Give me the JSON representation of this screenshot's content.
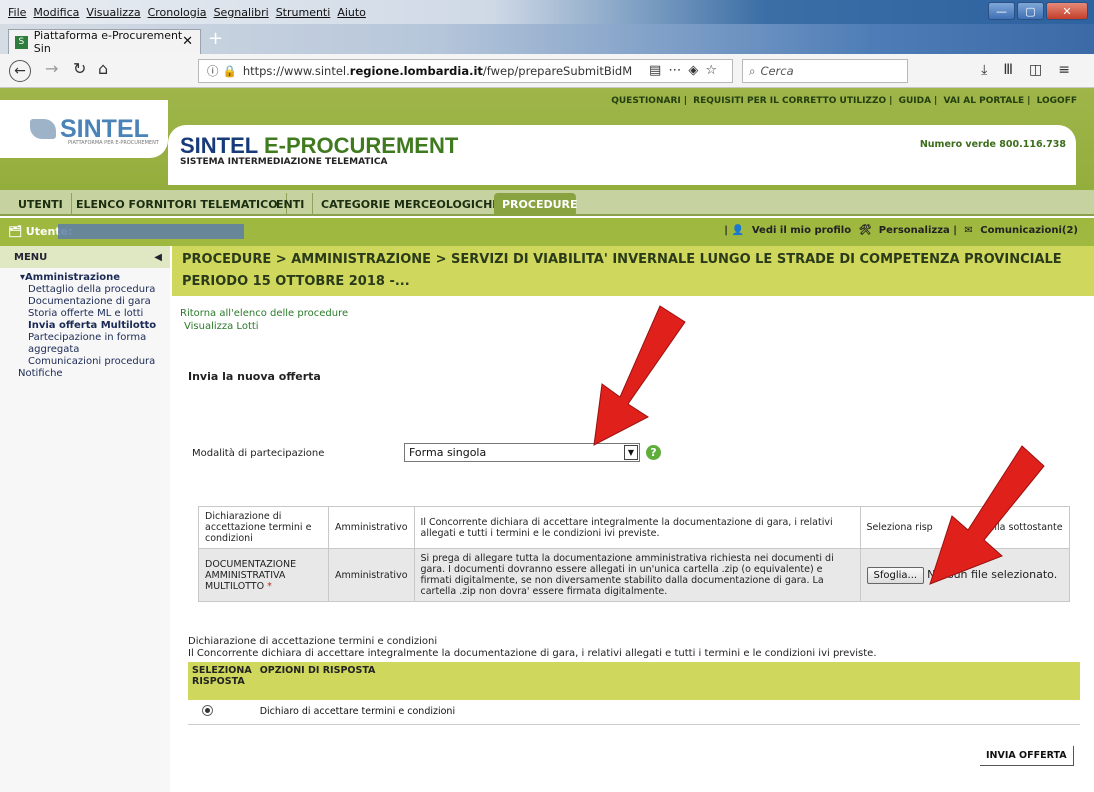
{
  "browser": {
    "menu": [
      "File",
      "Modifica",
      "Visualizza",
      "Cronologia",
      "Segnalibri",
      "Strumenti",
      "Aiuto"
    ],
    "tab_title": "Piattaforma e-Procurement Sin",
    "url_prefix": "https://www.sintel.",
    "url_domain": "regione.lombardia.it",
    "url_path": "/fwep/prepareSubmitBidM",
    "search_placeholder": "Cerca"
  },
  "site": {
    "logo_text": "SINTEL",
    "logo_sub": "PIATTAFORMA PER E-PROCUREMENT",
    "top_links": [
      "QUESTIONARI",
      "REQUISITI PER IL CORRETTO UTILIZZO",
      "GUIDA",
      "VAI AL PORTALE",
      "LOGOFF"
    ],
    "title_a": "SINTEL ",
    "title_b": "E-PROCUREMENT",
    "subtitle": "SISTEMA INTERMEDIAZIONE TELEMATICA",
    "numero_verde": "Numero verde 800.116.738"
  },
  "nav_tabs": [
    "UTENTI",
    "ELENCO FORNITORI TELEMATICO",
    "ENTI",
    "CATEGORIE MERCEOLOGICHE",
    "PROCEDURE"
  ],
  "userbar": {
    "user_label": "Utente:",
    "profile": "Vedi il mio profilo",
    "personalizza": "Personalizza",
    "comunicazioni": "Comunicazioni(2)"
  },
  "sidebar": {
    "menu_label": "MENU",
    "group": "Amministrazione",
    "items": [
      "Dettaglio della procedura",
      "Documentazione di gara",
      "Storia offerte ML e lotti",
      "Invia offerta Multilotto",
      "Partecipazione in forma",
      "aggregata",
      "Comunicazioni procedura"
    ],
    "notifiche": "Notifiche"
  },
  "breadcrumb": "PROCEDURE > AMMINISTRAZIONE > SERVIZI DI VIABILITA' INVERNALE LUNGO LE STRADE DI COMPETENZA PROVINCIALE PERIODO 15 OTTOBRE 2018 -...",
  "main": {
    "link_back": "Ritorna all'elenco delle procedure",
    "link_lotti": "Visualizza Lotti",
    "heading": "Invia la nuova offerta",
    "modalita_label": "Modalità di partecipazione",
    "modalita_value": "Forma singola",
    "rows": [
      {
        "name": "Dichiarazione di accettazione termini e condizioni",
        "type": "Amministrativo",
        "desc": "Il Concorrente dichiara di accettare integralmente la documentazione di gara, i relativi allegati e tutti i termini e le condizioni ivi previste.",
        "action": "Seleziona risp",
        "action_tail": "abella sottostante"
      },
      {
        "name": "DOCUMENTAZIONE AMMINISTRATIVA MULTILOTTO",
        "type": "Amministrativo",
        "desc": "Si prega di allegare tutta la documentazione amministrativa richiesta nei documenti di gara. I documenti dovranno essere allegati in un'unica cartella .zip (o equivalente) e firmati digitalmente, se non diversamente stabilito dalla documentazione di gara. La cartella .zip non dovra' essere firmata digitalmente.",
        "browse_label": "Sfoglia...",
        "no_file": "Nessun file selezionato."
      }
    ],
    "decl_title": "Dichiarazione di accettazione termini e condizioni",
    "decl_text": "Il Concorrente dichiara di accettare integralmente la documentazione di gara, i relativi allegati e tutti i termini e le condizioni ivi previste.",
    "resp_headers": [
      "SELEZIONA RISPOSTA",
      "OPZIONI DI RISPOSTA"
    ],
    "resp_option": "Dichiaro di accettare termini e condizioni",
    "submit": "INVIA OFFERTA"
  },
  "colors": {
    "site_green": "#9fb83f",
    "crumb": "#cfd85c",
    "arrow": "#e0201a",
    "title_blue": "#173a7a"
  }
}
